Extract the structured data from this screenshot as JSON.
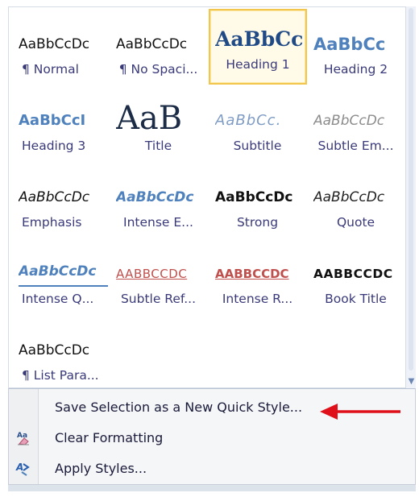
{
  "gallery": {
    "tiles": [
      {
        "sample": "AaBbCcDc",
        "label": "¶ Normal",
        "style": "s-normal"
      },
      {
        "sample": "AaBbCcDc",
        "label": "¶ No Spaci...",
        "style": "s-normal"
      },
      {
        "sample": "AaBbCc",
        "label": "Heading 1",
        "style": "s-h1",
        "selected": true
      },
      {
        "sample": "AaBbCc",
        "label": "Heading 2",
        "style": "s-h2"
      },
      {
        "sample": "AaBbCcI",
        "label": "Heading 3",
        "style": "s-h3"
      },
      {
        "sample": "AaB",
        "label": "Title",
        "style": "s-title"
      },
      {
        "sample": "AaBbCc.",
        "label": "Subtitle",
        "style": "s-subtitle"
      },
      {
        "sample": "AaBbCcDc",
        "label": "Subtle Em...",
        "style": "s-subemph"
      },
      {
        "sample": "AaBbCcDc",
        "label": "Emphasis",
        "style": "s-emph"
      },
      {
        "sample": "AaBbCcDc",
        "label": "Intense E...",
        "style": "s-intemph"
      },
      {
        "sample": "AaBbCcDc",
        "label": "Strong",
        "style": "s-strong"
      },
      {
        "sample": "AaBbCcDc",
        "label": "Quote",
        "style": "s-quote"
      },
      {
        "sample": "AaBbCcDc",
        "label": "Intense Q...",
        "style": "s-intquote"
      },
      {
        "sample": "AABBCCDC",
        "label": "Subtle Ref...",
        "style": "s-subref"
      },
      {
        "sample": "AABBCCDC",
        "label": "Intense R...",
        "style": "s-intref"
      },
      {
        "sample": "AABBCCDC",
        "label": "Book Title",
        "style": "s-book"
      },
      {
        "sample": "AaBbCcDc",
        "label": "¶ List Para...",
        "style": "s-normal"
      }
    ]
  },
  "menu": {
    "save_label": "Save Selection as a New Quick Style...",
    "clear_label": "Clear Formatting",
    "apply_label": "Apply Styles..."
  },
  "icons": {
    "clear": "clear-formatting-icon",
    "apply": "apply-styles-icon",
    "arrow": "red-arrow-icon"
  },
  "colors": {
    "accent_blue": "#4f81bd",
    "selected_border": "#f2c64d",
    "arrow_red": "#e0101a"
  }
}
